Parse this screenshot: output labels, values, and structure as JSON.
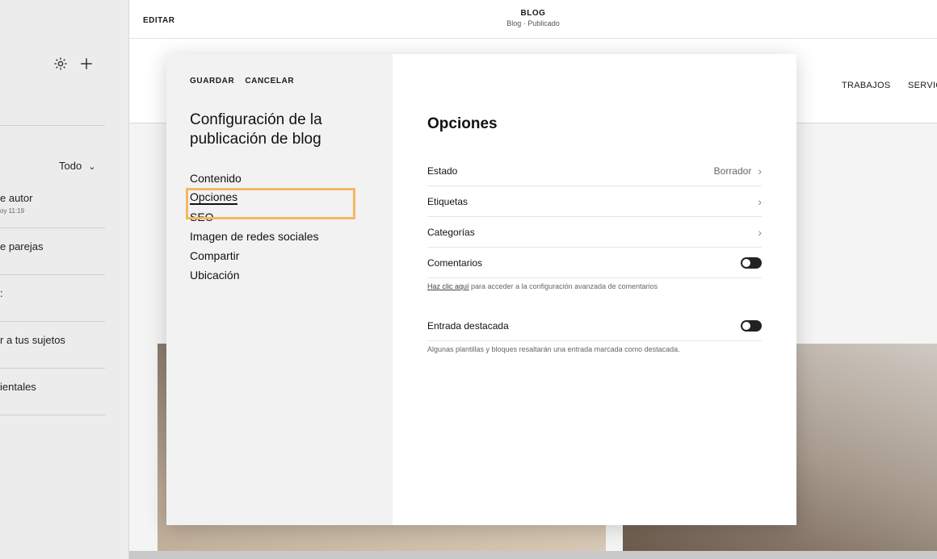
{
  "left_panel": {
    "filter_label": "Todo",
    "items": [
      {
        "title": "e autor",
        "sub": "oy 11:19"
      },
      {
        "title": "e parejas",
        "sub": ""
      },
      {
        "title": ":",
        "sub": ""
      },
      {
        "title": "r a tus sujetos",
        "sub": ""
      },
      {
        "title": "ientales",
        "sub": ""
      }
    ]
  },
  "topbar": {
    "edit_label": "EDITAR",
    "page_title": "BLOG",
    "page_subtitle": "Blog · Publicado"
  },
  "site_nav": {
    "items": [
      "TRABAJOS",
      "SERVIC"
    ]
  },
  "modal": {
    "save_label": "GUARDAR",
    "cancel_label": "CANCELAR",
    "title": "Configuración de la publicación de blog",
    "nav": [
      {
        "label": "Contenido"
      },
      {
        "label": "Opciones"
      },
      {
        "label": "SEO"
      },
      {
        "label": "Imagen de redes sociales"
      },
      {
        "label": "Compartir"
      },
      {
        "label": "Ubicación"
      }
    ],
    "active_nav": "Opciones",
    "highlight_color": "#f4b860",
    "options_title": "Opciones",
    "rows": {
      "estado": {
        "label": "Estado",
        "value": "Borrador"
      },
      "etiquetas": {
        "label": "Etiquetas"
      },
      "categorias": {
        "label": "Categorías"
      },
      "comentarios": {
        "label": "Comentarios",
        "enabled": false
      },
      "destacada": {
        "label": "Entrada destacada",
        "enabled": false
      }
    },
    "comments_note_link": "Haz clic aquí",
    "comments_note_text": " para acceder a la configuración avanzada de comentarios",
    "featured_note": "Algunas plantillas y bloques resaltarán una entrada marcada como destacada."
  }
}
